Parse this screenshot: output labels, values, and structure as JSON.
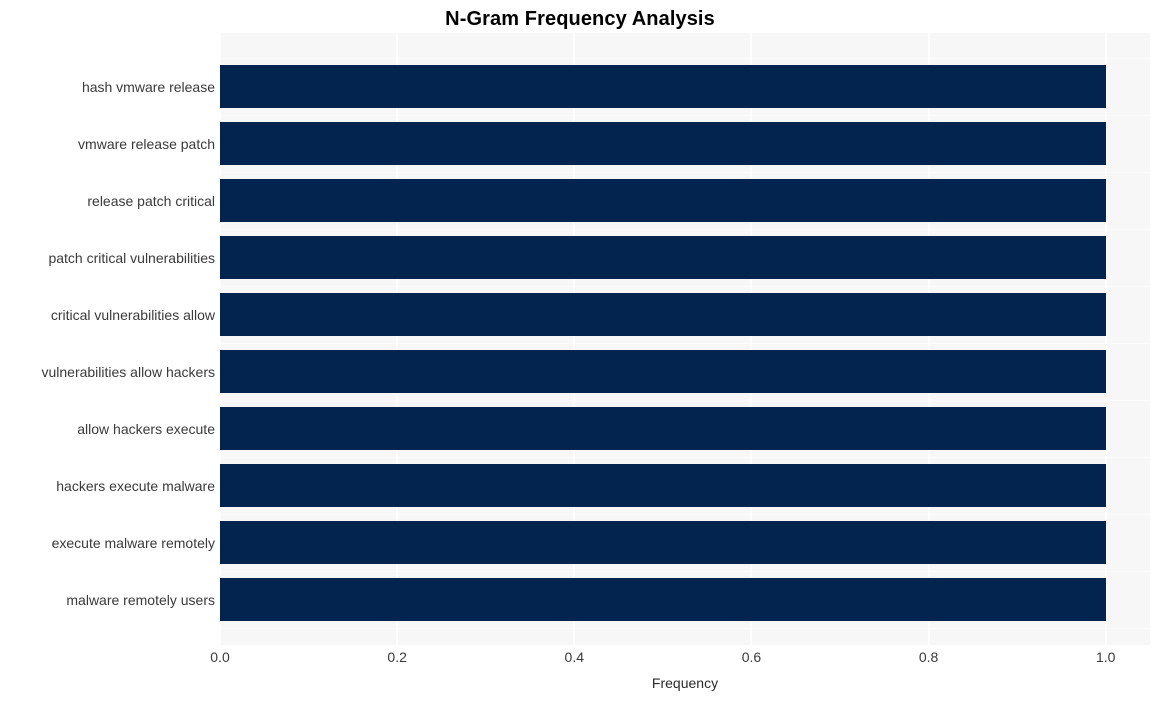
{
  "chart_data": {
    "type": "bar",
    "orientation": "horizontal",
    "title": "N-Gram Frequency Analysis",
    "xlabel": "Frequency",
    "ylabel": "",
    "categories": [
      "hash vmware release",
      "vmware release patch",
      "release patch critical",
      "patch critical vulnerabilities",
      "critical vulnerabilities allow",
      "vulnerabilities allow hackers",
      "allow hackers execute",
      "hackers execute malware",
      "execute malware remotely",
      "malware remotely users"
    ],
    "values": [
      1.0,
      1.0,
      1.0,
      1.0,
      1.0,
      1.0,
      1.0,
      1.0,
      1.0,
      1.0
    ],
    "xlim": [
      0.0,
      1.05
    ],
    "xticks": [
      "0.0",
      "0.2",
      "0.4",
      "0.6",
      "0.8",
      "1.0"
    ],
    "xtick_values": [
      0.0,
      0.2,
      0.4,
      0.6,
      0.8,
      1.0
    ],
    "grid": true,
    "legend": null,
    "bar_color": "#042450",
    "plot_background": "#f7f7f7",
    "gridline_color": "#ffffff",
    "figure_background": "#ffffff",
    "text_color": "#3a3a3a"
  }
}
